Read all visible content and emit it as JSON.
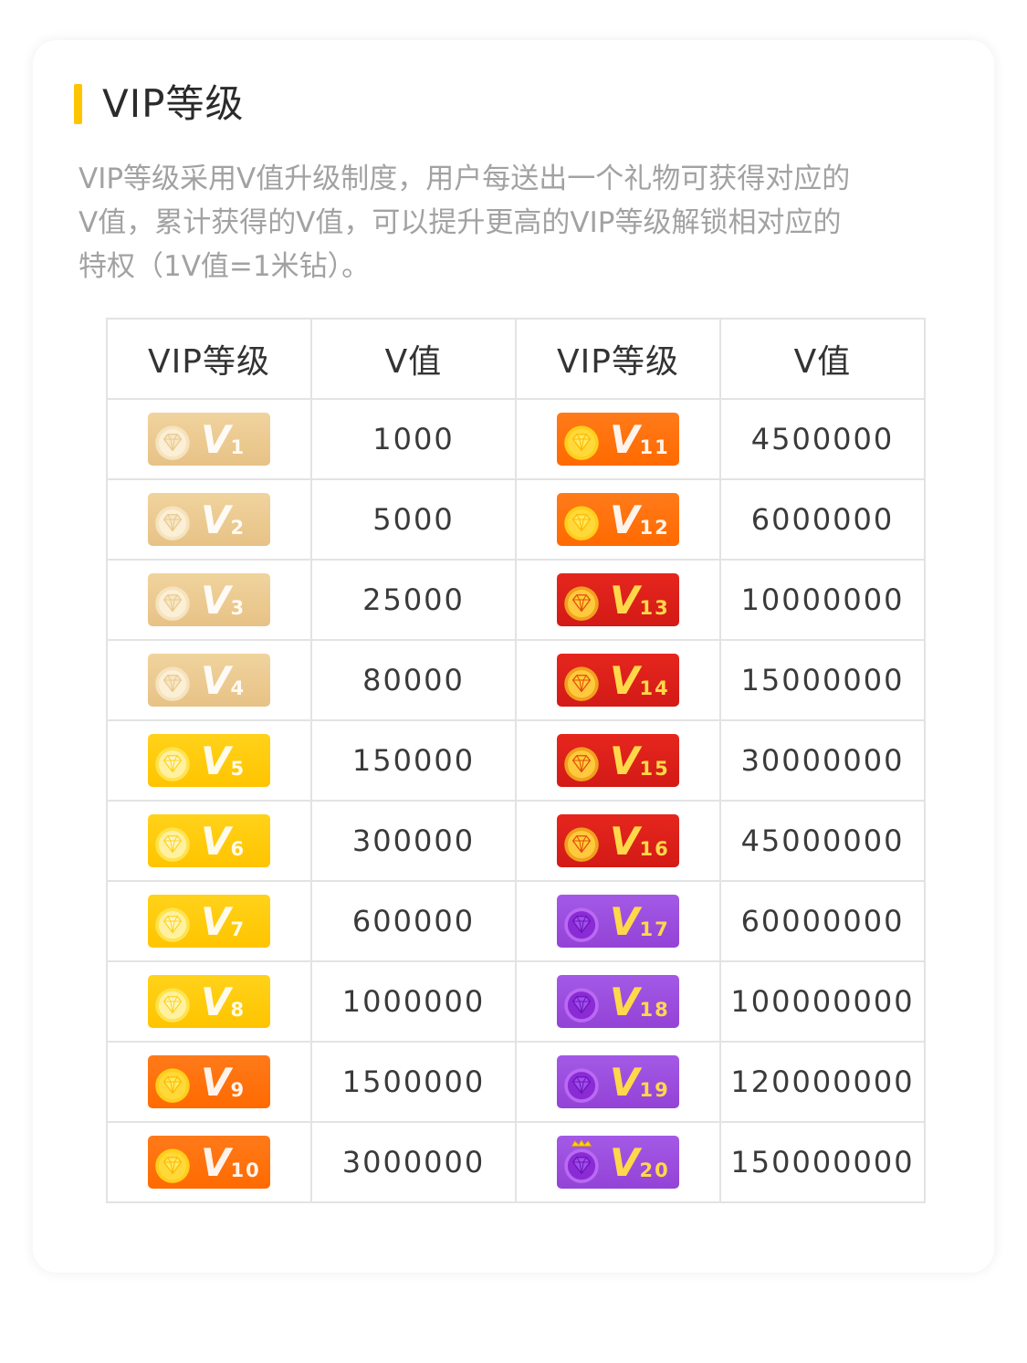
{
  "section": {
    "title": "VIP等级",
    "description_lines": [
      "VIP等级采用V值升级制度，用户每送出一个礼物可获得对应的",
      "V值，累计获得的V值，可以提升更高的VIP等级解锁相对应的",
      "特权（1V值=1米钻）。"
    ]
  },
  "table": {
    "headers": [
      "VIP等级",
      "V值",
      "VIP等级",
      "V值"
    ],
    "rows": [
      {
        "left": {
          "level": "1",
          "value": "1000",
          "tier": "sand"
        },
        "right": {
          "level": "11",
          "value": "4500000",
          "tier": "orange"
        }
      },
      {
        "left": {
          "level": "2",
          "value": "5000",
          "tier": "sand"
        },
        "right": {
          "level": "12",
          "value": "6000000",
          "tier": "orange"
        }
      },
      {
        "left": {
          "level": "3",
          "value": "25000",
          "tier": "sand"
        },
        "right": {
          "level": "13",
          "value": "10000000",
          "tier": "red"
        }
      },
      {
        "left": {
          "level": "4",
          "value": "80000",
          "tier": "sand"
        },
        "right": {
          "level": "14",
          "value": "15000000",
          "tier": "red"
        }
      },
      {
        "left": {
          "level": "5",
          "value": "150000",
          "tier": "gold"
        },
        "right": {
          "level": "15",
          "value": "30000000",
          "tier": "red"
        }
      },
      {
        "left": {
          "level": "6",
          "value": "300000",
          "tier": "gold"
        },
        "right": {
          "level": "16",
          "value": "45000000",
          "tier": "red"
        }
      },
      {
        "left": {
          "level": "7",
          "value": "600000",
          "tier": "gold"
        },
        "right": {
          "level": "17",
          "value": "60000000",
          "tier": "purple"
        }
      },
      {
        "left": {
          "level": "8",
          "value": "1000000",
          "tier": "gold"
        },
        "right": {
          "level": "18",
          "value": "100000000",
          "tier": "purple"
        }
      },
      {
        "left": {
          "level": "9",
          "value": "1500000",
          "tier": "orange"
        },
        "right": {
          "level": "19",
          "value": "120000000",
          "tier": "purple"
        }
      },
      {
        "left": {
          "level": "10",
          "value": "3000000",
          "tier": "orange"
        },
        "right": {
          "level": "20",
          "value": "150000000",
          "tier": "purple",
          "crown": true
        }
      }
    ]
  },
  "colors": {
    "accent": "#ffc400",
    "tier_sand": "#e9c68b",
    "tier_gold": "#ffc80a",
    "tier_orange": "#ff6d05",
    "tier_red": "#d81f19",
    "tier_purple": "#9a4ddc"
  },
  "icons": {
    "badge_gem": "diamond-icon",
    "badge_crown": "crown-icon"
  }
}
